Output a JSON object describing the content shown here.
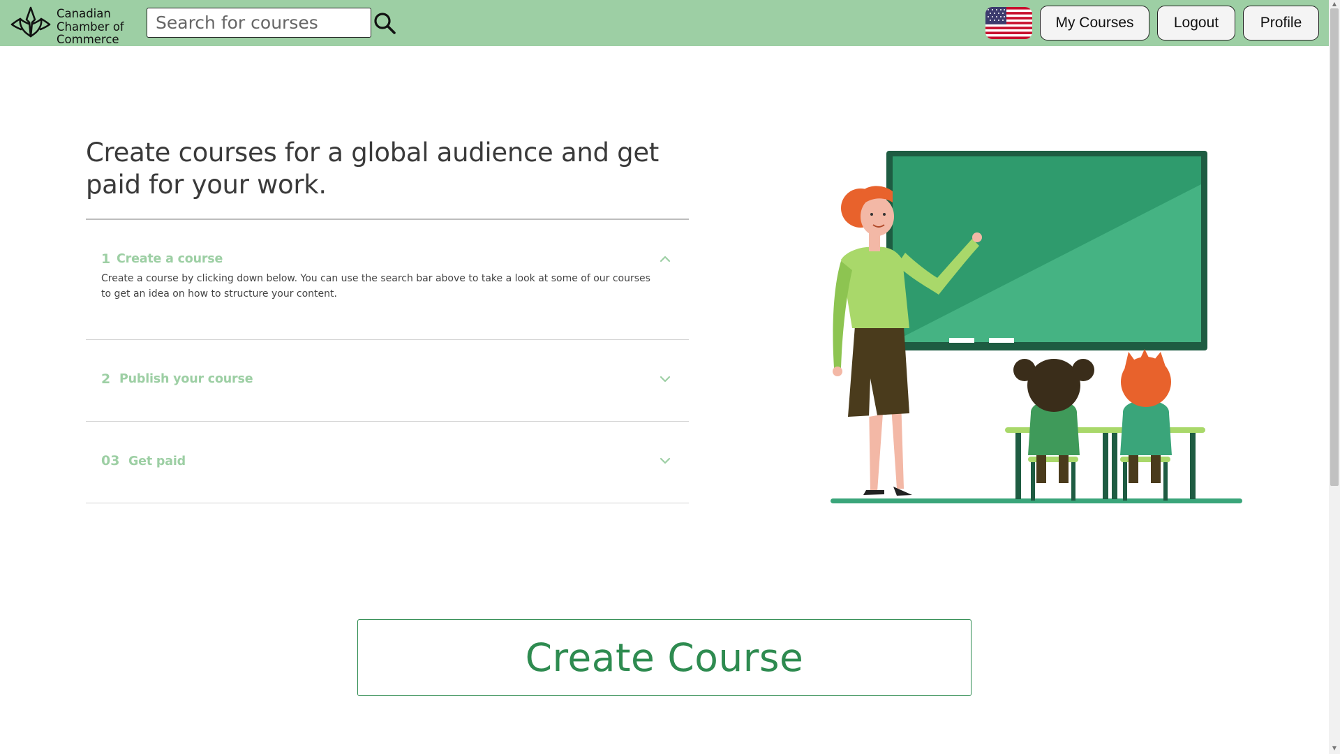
{
  "header": {
    "logo_text": "Canadian\nChamber of\nCommerce",
    "search": {
      "placeholder": "Search for courses",
      "value": ""
    },
    "language_flag": "us-flag-icon",
    "nav": [
      {
        "label": "My Courses"
      },
      {
        "label": "Logout"
      },
      {
        "label": "Profile"
      }
    ],
    "colors": {
      "bar": "#9dcfa4",
      "button_bg": "#f4f4f4"
    }
  },
  "hero": {
    "headline": "Create courses for a global audience and get paid for your work.",
    "steps": [
      {
        "number": "1",
        "title": "Create a course",
        "expanded": true,
        "body": "Create a course by clicking down below. You can use the search bar above to take a look at some of our courses to get an idea on how to structure your content."
      },
      {
        "number": "2",
        "title": "Publish your course",
        "expanded": false
      },
      {
        "number": "03",
        "title": "Get paid",
        "expanded": false
      }
    ],
    "illustration": "teacher-with-chalkboard-and-students"
  },
  "cta": {
    "label": "Create Course",
    "color": "#2e8b50"
  },
  "theme": {
    "accent_green": "#9dcfa4",
    "cta_green": "#2e8b50"
  }
}
